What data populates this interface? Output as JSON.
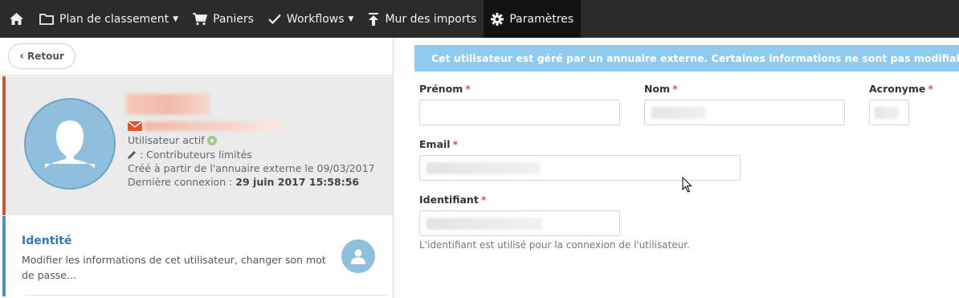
{
  "nav": {
    "home_icon": "home-icon",
    "items": [
      {
        "label": "Plan de classement",
        "icon": "folder-icon",
        "dropdown": true
      },
      {
        "label": "Paniers",
        "icon": "cart-icon",
        "dropdown": false
      },
      {
        "label": "Workflows",
        "icon": "check-icon",
        "dropdown": true
      },
      {
        "label": "Mur des imports",
        "icon": "upload-icon",
        "dropdown": false
      },
      {
        "label": "Paramètres",
        "icon": "gear-icon",
        "dropdown": false,
        "active": true
      }
    ],
    "caret": "▼"
  },
  "back_button": {
    "label": "Retour",
    "chevron": "‹"
  },
  "profile": {
    "status": "Utilisateur actif",
    "role": ": Contributeurs limités",
    "created": "Créé à partir de l'annuaire externe le 09/03/2017",
    "last_login_label": "Dernière connexion : ",
    "last_login_value": "29 juin 2017 15:58:56"
  },
  "identity_card": {
    "title": "Identité",
    "description": "Modifier les informations de cet utilisateur, changer son mot de passe..."
  },
  "alert": {
    "text": "Cet utilisateur est géré par un annuaire externe. Certaines informations ne sont pas modifiables.",
    "color": "#90cbed"
  },
  "form": {
    "required_marker": "*",
    "firstname_label": "Prénom",
    "lastname_label": "Nom",
    "acronym_label": "Acronyme",
    "email_label": "Email",
    "identifier_label": "Identifiant",
    "identifier_help": "L'identifiant est utilisé pour la connexion de l'utilisateur."
  },
  "colors": {
    "nav_bg": "#2b2b2b",
    "profile_accent": "#d2562e",
    "identity_accent": "#4a90c2",
    "required": "#d9534f"
  }
}
